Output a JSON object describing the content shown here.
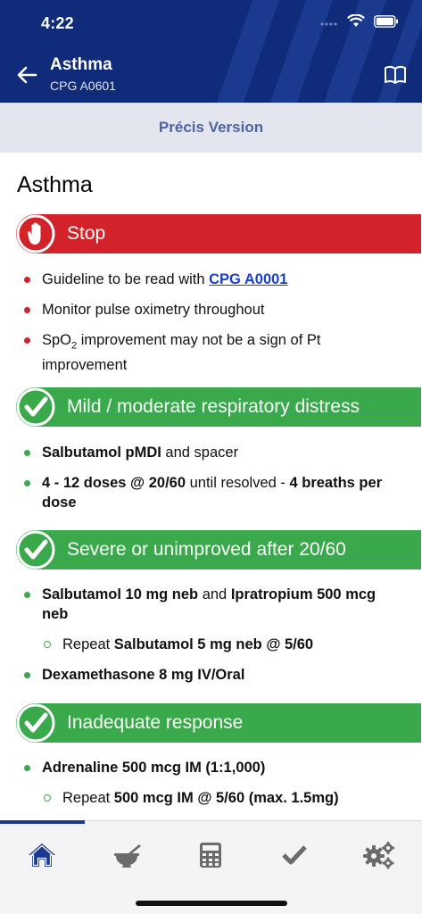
{
  "status_bar": {
    "time": "4:22"
  },
  "header": {
    "title": "Asthma",
    "subtitle": "CPG A0601",
    "colors": {
      "background": "#0f2b7a"
    }
  },
  "precis": {
    "label": "Précis Version"
  },
  "content": {
    "title": "Asthma",
    "sections": [
      {
        "label": "Stop",
        "color": "#d32229",
        "icon": "stop-hand-icon",
        "items": [
          {
            "text_before": "Guideline to be read with ",
            "link": "CPG A0001"
          },
          {
            "text": "Monitor pulse oximetry throughout"
          },
          {
            "prefix": "SpO",
            "subscript": "2",
            "text": " improvement may not be a sign of Pt improvement"
          }
        ]
      },
      {
        "label": "Mild / moderate respiratory distress",
        "color": "#3aa94b",
        "icon": "check-circle-icon",
        "items": [
          {
            "bold1": "Salbutamol pMDI",
            "text1": " and spacer"
          },
          {
            "bold1": "4 - 12 doses @ 20/60",
            "text1": " until resolved - ",
            "bold2": "4 breaths per dose"
          }
        ]
      },
      {
        "label": "Severe or unimproved after 20/60",
        "color": "#3aa94b",
        "icon": "check-circle-icon",
        "items": [
          {
            "bold1": "Salbutamol 10 mg neb",
            "text1": " and ",
            "bold2": "Ipratropium 500 mcg neb"
          },
          {
            "text1": "Repeat ",
            "bold1": "Salbutamol 5 mg neb @ 5/60"
          },
          {
            "bold1": "Dexamethasone 8 mg IV/Oral"
          }
        ]
      },
      {
        "label": "Inadequate response",
        "color": "#3aa94b",
        "icon": "check-circle-icon",
        "items": [
          {
            "bold1": "Adrenaline 500 mcg IM (1:1,000)"
          },
          {
            "text1": "Repeat ",
            "bold1": "500 mcg IM @ 5/60 (max. 1.5mg)"
          }
        ]
      }
    ]
  },
  "tabbar": {
    "tabs": [
      {
        "icon": "home-icon",
        "active": true
      },
      {
        "icon": "mortar-pestle-icon"
      },
      {
        "icon": "calculator-icon"
      },
      {
        "icon": "checkmark-icon"
      },
      {
        "icon": "gears-icon"
      }
    ],
    "active_color": "#1a3a8f",
    "inactive_color": "#6b6b6b"
  }
}
